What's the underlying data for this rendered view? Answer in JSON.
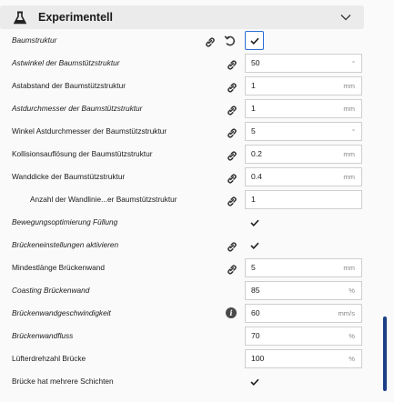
{
  "section": {
    "title": "Experimentell"
  },
  "colors": {
    "accent": "#2a6fd6",
    "scrollbar": "#1b3f88"
  },
  "rows": [
    {
      "label": "Baumstruktur",
      "italic": true,
      "icon": "link-icon",
      "reset": true,
      "type": "checkbox",
      "checked": true,
      "highlighted": true
    },
    {
      "label": "Astwinkel der Baumstützstruktur",
      "italic": true,
      "icon": "link-icon",
      "type": "field",
      "value": "50",
      "unit": "°"
    },
    {
      "label": "Astabstand der Baumstützstruktur",
      "italic": false,
      "icon": "link-icon",
      "type": "field",
      "value": "1",
      "unit": "mm"
    },
    {
      "label": "Astdurchmesser der Baumstützstruktur",
      "italic": true,
      "icon": "link-icon",
      "type": "field",
      "value": "1",
      "unit": "mm"
    },
    {
      "label": "Winkel Astdurchmesser der Baumstützstruktur",
      "italic": false,
      "icon": "link-icon",
      "type": "field",
      "value": "5",
      "unit": "°"
    },
    {
      "label": "Kollisionsauflösung der Baumstützstruktur",
      "italic": false,
      "icon": "link-icon",
      "type": "field",
      "value": "0.2",
      "unit": "mm"
    },
    {
      "label": "Wanddicke der Baumstützstruktur",
      "italic": false,
      "icon": "link-icon",
      "type": "field",
      "value": "0.4",
      "unit": "mm"
    },
    {
      "label": "Anzahl der Wandlinie...er Baumstützstruktur",
      "italic": false,
      "indent": true,
      "icon": "link-icon",
      "type": "field",
      "value": "1",
      "unit": ""
    },
    {
      "label": "Bewegungsoptimierung Füllung",
      "italic": true,
      "type": "checkbox",
      "checked": true
    },
    {
      "label": "Brückeneinstellungen aktivieren",
      "italic": true,
      "icon": "link-icon",
      "type": "checkbox",
      "checked": true
    },
    {
      "label": "Mindestlänge Brückenwand",
      "italic": false,
      "icon": "link-icon",
      "type": "field",
      "value": "5",
      "unit": "mm"
    },
    {
      "label": "Coasting Brückenwand",
      "italic": true,
      "type": "field",
      "value": "85",
      "unit": "%"
    },
    {
      "label": "Brückenwandgeschwindigkeit",
      "italic": true,
      "icon": "info-icon",
      "type": "field",
      "value": "60",
      "unit": "mm/s"
    },
    {
      "label": "Brückenwandfluss",
      "italic": true,
      "type": "field",
      "value": "70",
      "unit": "%"
    },
    {
      "label": "Lüfterdrehzahl Brücke",
      "italic": false,
      "type": "field",
      "value": "100",
      "unit": "%"
    },
    {
      "label": "Brücke hat mehrere Schichten",
      "italic": false,
      "type": "checkbox",
      "checked": true
    }
  ]
}
